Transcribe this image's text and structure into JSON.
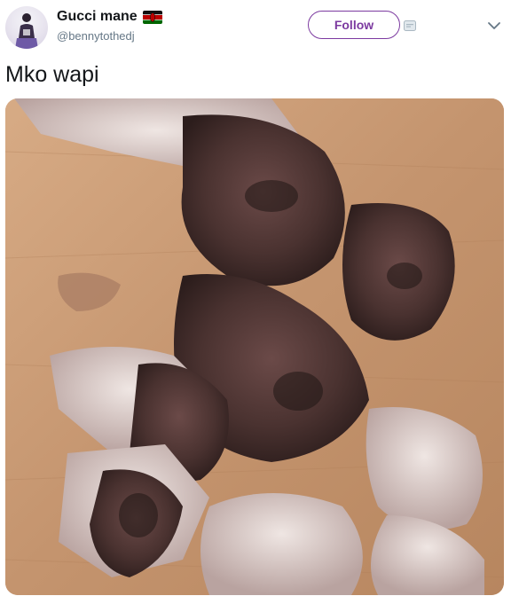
{
  "tweet": {
    "display_name": "Gucci mane",
    "handle": "@bennytothedj",
    "text": "Mko wapi",
    "follow_label": "Follow",
    "flag_icon": "kenya-flag-icon",
    "accent_color": "#7c3aa0"
  },
  "media": {
    "type": "photo"
  }
}
